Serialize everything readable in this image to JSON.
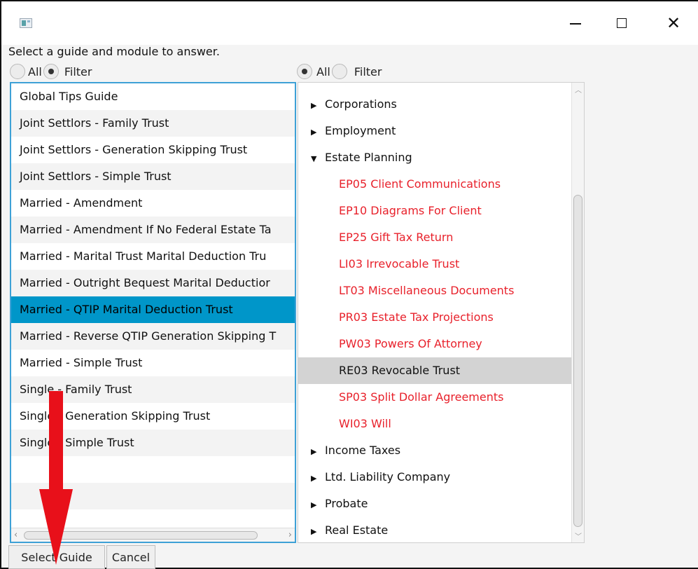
{
  "window": {
    "icon": "app-icon",
    "controls": {
      "minimize_icon": "minimize-icon",
      "maximize_icon": "maximize-icon",
      "close_symbol": "✕"
    }
  },
  "prompt": "Select a guide and module to answer.",
  "left_filter": {
    "all_label": "All",
    "filter_label": "Filter",
    "selected": "Filter"
  },
  "right_filter": {
    "all_label": "All",
    "filter_label": "Filter",
    "selected": "All"
  },
  "guides": [
    "Global Tips Guide",
    "Joint Settlors - Family Trust",
    "Joint Settlors - Generation Skipping Trust",
    "Joint Settlors - Simple Trust",
    "Married - Amendment",
    "Married - Amendment If No Federal Estate Ta",
    "Married - Marital Trust Marital Deduction Tru",
    "Married - Outright Bequest Marital Deductior",
    "Married - QTIP Marital Deduction Trust",
    "Married - Reverse QTIP Generation Skipping T",
    "Married - Simple Trust",
    "Single - Family Trust",
    "Single - Generation Skipping Trust",
    "Single - Simple Trust"
  ],
  "selected_guide": "Married - QTIP Marital Deduction Trust",
  "modules": [
    {
      "label": "Corporations",
      "type": "parent",
      "expanded": false
    },
    {
      "label": "Employment",
      "type": "parent",
      "expanded": false
    },
    {
      "label": "Estate Planning",
      "type": "parent",
      "expanded": true
    },
    {
      "label": "EP05 Client Communications",
      "type": "child"
    },
    {
      "label": "EP10 Diagrams For Client",
      "type": "child"
    },
    {
      "label": "EP25 Gift Tax Return",
      "type": "child"
    },
    {
      "label": "LI03 Irrevocable Trust",
      "type": "child"
    },
    {
      "label": "LT03 Miscellaneous Documents",
      "type": "child"
    },
    {
      "label": "PR03 Estate Tax Projections",
      "type": "child"
    },
    {
      "label": "PW03 Powers Of Attorney",
      "type": "child"
    },
    {
      "label": "RE03 Revocable Trust",
      "type": "child",
      "selected": true
    },
    {
      "label": "SP03 Split Dollar Agreements",
      "type": "child"
    },
    {
      "label": "WI03 Will",
      "type": "child"
    },
    {
      "label": "Income Taxes",
      "type": "parent",
      "expanded": false
    },
    {
      "label": "Ltd. Liability Company",
      "type": "parent",
      "expanded": false
    },
    {
      "label": "Probate",
      "type": "parent",
      "expanded": false
    },
    {
      "label": "Real Estate",
      "type": "parent",
      "expanded": false
    }
  ],
  "buttons": {
    "select_guide": "Select Guide",
    "cancel": "Cancel"
  },
  "colors": {
    "selection_blue": "#0096c9",
    "module_red": "#e8212b",
    "list_border": "#3ea1d6",
    "annotation_red": "#e8101a"
  }
}
